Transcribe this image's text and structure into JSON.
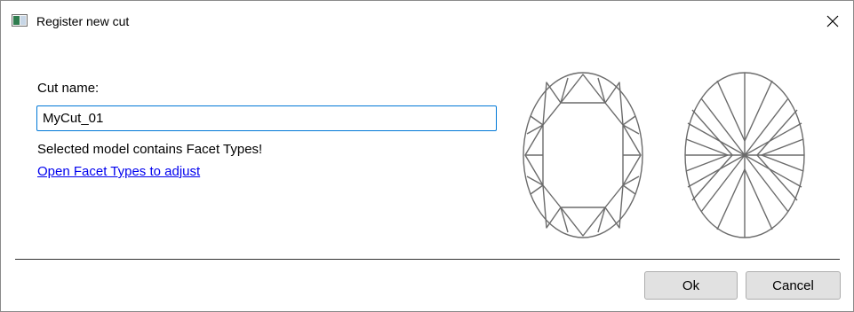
{
  "window": {
    "title": "Register new cut",
    "icon": "app-icon"
  },
  "form": {
    "cut_name_label": "Cut name:",
    "cut_name_value": "MyCut_01",
    "message": "Selected model contains Facet Types!",
    "link_text": "Open Facet Types to adjust"
  },
  "preview": {
    "crown_icon": "oval-cut-crown-diagram",
    "pavilion_icon": "oval-cut-pavilion-diagram",
    "stroke_color": "#6b6b6b"
  },
  "buttons": {
    "ok_label": "Ok",
    "cancel_label": "Cancel"
  }
}
